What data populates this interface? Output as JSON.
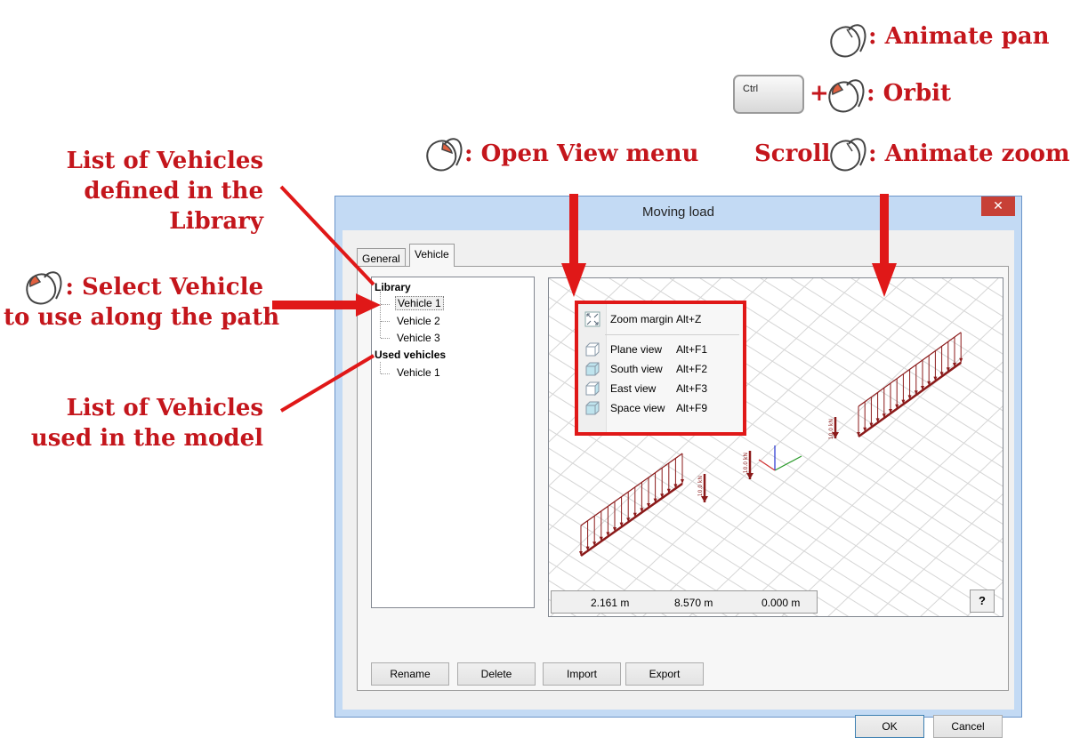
{
  "annotations": {
    "animate_pan": ": Animate pan",
    "ctrl_key": "Ctrl",
    "orbit_plus": "+",
    "orbit": ": Orbit",
    "scroll": "Scroll",
    "animate_zoom": ": Animate zoom",
    "open_view_menu": ": Open View menu",
    "list_library_1": "List of Vehicles",
    "list_library_2": "defined in the",
    "list_library_3": "Library",
    "select_vehicle_1": ": Select Vehicle",
    "select_vehicle_2": "to use along the path",
    "list_used_1": "List of Vehicles",
    "list_used_2": "used in the model"
  },
  "window": {
    "title": "Moving load",
    "close_glyph": "✕",
    "tabs": [
      "General",
      "Vehicle"
    ]
  },
  "tree": {
    "library_label": "Library",
    "library_items": [
      "Vehicle 1",
      "Vehicle 2",
      "Vehicle 3"
    ],
    "used_label": "Used vehicles",
    "used_items": [
      "Vehicle 1"
    ]
  },
  "view_menu": [
    {
      "label": "Zoom margin",
      "shortcut": "Alt+Z",
      "icon": "zoom-margin-icon"
    },
    {
      "label": "Plane view",
      "shortcut": "Alt+F1",
      "icon": "cube-icon"
    },
    {
      "label": "South view",
      "shortcut": "Alt+F2",
      "icon": "cube-icon"
    },
    {
      "label": "East view",
      "shortcut": "Alt+F3",
      "icon": "cube-icon"
    },
    {
      "label": "Space view",
      "shortcut": "Alt+F9",
      "icon": "cube-icon"
    }
  ],
  "coords": {
    "x": "2.161 m",
    "y": "8.570 m",
    "z": "0.000 m"
  },
  "help_button": "?",
  "buttons": {
    "rename": "Rename",
    "delete": "Delete",
    "import": "Import",
    "export": "Export",
    "ok": "OK",
    "cancel": "Cancel"
  },
  "load_labels": {
    "kn": "10.0 kN"
  },
  "colors": {
    "annotation": "#c4161c",
    "load": "#8b1a1a",
    "close": "#c74036"
  }
}
